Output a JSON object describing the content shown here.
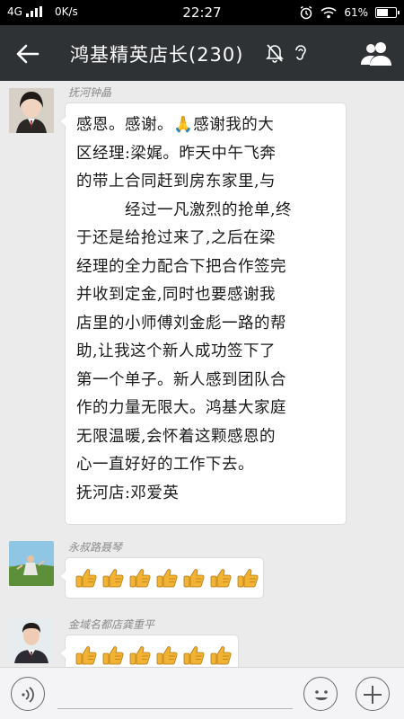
{
  "status_bar": {
    "network": "4G",
    "speed": "0K/s",
    "time": "22:27",
    "battery": "61%",
    "battery_level": 0.61
  },
  "header": {
    "title": "鸿基精英店长(230)",
    "icons": [
      "back-arrow-icon",
      "mute-bell-icon",
      "earpiece-icon",
      "group-members-icon"
    ]
  },
  "messages": [
    {
      "sender": "抚河钟晶",
      "lines": [
        "感恩。感谢。🙏感谢我的大",
        "区经理:梁娓。昨天中午飞奔",
        "的带上合同赶到房东家里,与",
        "　　　经过一凡激烈的抢单,终",
        "于还是给抢过来了,之后在梁",
        "经理的全力配合下把合作签完",
        "并收到定金,同时也要感谢我",
        "店里的小师傅刘金彪一路的帮",
        "助,让我这个新人成功签下了",
        "第一个单子。新人感到团队合",
        "作的力量无限大。鸿基大家庭",
        "无限温暖,会怀着这颗感恩的",
        "心一直好好的工作下去。",
        "抚河店:邓爱英"
      ]
    },
    {
      "sender": "永叔路聂琴",
      "emoji": "thumbs-up-icon",
      "count": 7
    },
    {
      "sender": "金域名都店龚重平",
      "emoji": "thumbs-up-icon",
      "count": 6
    }
  ],
  "input_bar": {
    "value": "",
    "icons": [
      "voice-icon",
      "emoji-icon",
      "plus-icon"
    ]
  },
  "colors": {
    "header_bg": "#2f3235",
    "chat_bg": "#ebebeb",
    "bubble_bg": "#ffffff",
    "thumb": "#f2b233"
  }
}
